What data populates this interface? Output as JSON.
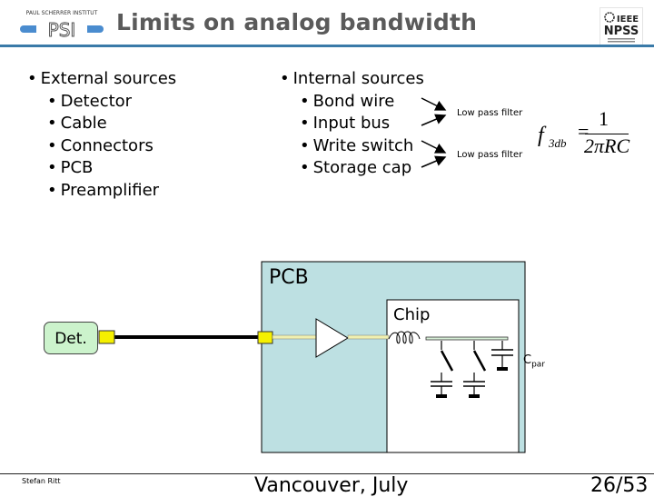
{
  "header": {
    "title": "Limits on analog bandwidth",
    "left_logo": {
      "icon": "psi-logo-icon",
      "caption": "PAUL SCHERRER INSTITUT",
      "mark": "PSI"
    },
    "right_logo": {
      "icon": "ieee-npss-logo-icon",
      "line1": "IEEE",
      "line2": "NPSS"
    }
  },
  "external": {
    "heading": "External sources",
    "items": [
      "Detector",
      "Cable",
      "Connectors",
      "PCB",
      "Preamplifier"
    ]
  },
  "internal": {
    "heading": "Internal sources",
    "items": [
      "Bond wire",
      "Input bus",
      "Write switch",
      "Storage cap"
    ]
  },
  "filters": [
    "Low pass filter",
    "Low pass filter"
  ],
  "formula": {
    "lhs": "f",
    "lhs_sub": "3db",
    "equals": "=",
    "numerator": "1",
    "denominator": "2πRC"
  },
  "diagram": {
    "pcb_label": "PCB",
    "chip_label": "Chip",
    "detector_label": "Det.",
    "cpar_label": "C",
    "cpar_sub": "par",
    "colors": {
      "pcb_fill": "#bde0e2",
      "detector_fill": "#ccf3cc",
      "connector_fill": "#f5f000",
      "signal_line": "#f0f0b0",
      "chip_bus": "#d8f0d8"
    }
  },
  "footer": {
    "author": "Stefan Ritt",
    "center": "Vancouver, July",
    "page": "26/53"
  }
}
